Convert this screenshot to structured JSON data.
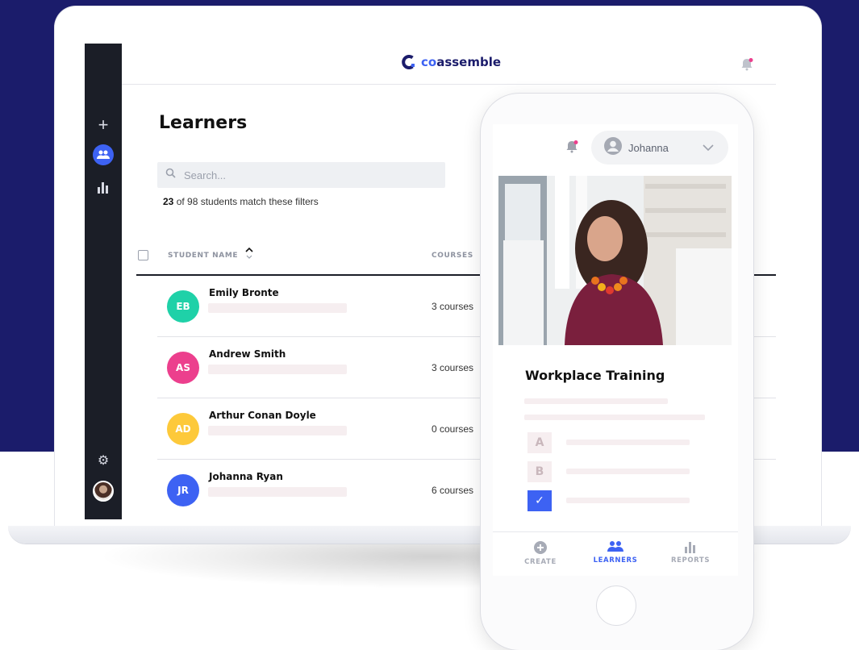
{
  "app": {
    "logo_text_co": "co",
    "logo_text_rest": "assemble",
    "accent_color": "#3d62f3",
    "navy_color": "#1b1c6b"
  },
  "sidebar": {
    "items": [
      {
        "name": "create",
        "icon": "plus-icon"
      },
      {
        "name": "learners",
        "icon": "users-icon",
        "active": true
      },
      {
        "name": "reports",
        "icon": "bar-chart-icon"
      },
      {
        "name": "settings",
        "icon": "gear-icon"
      },
      {
        "name": "profile",
        "icon": "avatar"
      }
    ]
  },
  "learners_page": {
    "title": "Learners",
    "search_placeholder": "Search...",
    "match_count": "23",
    "match_rest": " of 98 students match these filters",
    "columns": {
      "name": "STUDENT NAME",
      "courses": "COURSES"
    },
    "rows": [
      {
        "initials": "EB",
        "name": "Emily Bronte",
        "courses": "3 courses",
        "color": "#1fd1a8"
      },
      {
        "initials": "AS",
        "name": "Andrew Smith",
        "courses": "3 courses",
        "color": "#ec3f8d"
      },
      {
        "initials": "AD",
        "name": "Arthur Conan Doyle",
        "courses": "0 courses",
        "color": "#fdc93a"
      },
      {
        "initials": "JR",
        "name": "Johanna Ryan",
        "courses": "6 courses",
        "color": "#3d62f3"
      }
    ]
  },
  "phone": {
    "user_name": "Johanna",
    "course_title": "Workplace Training",
    "options": [
      "A",
      "B",
      "✓"
    ],
    "nav": [
      {
        "label": "CREATE",
        "icon": "plus-circle-icon"
      },
      {
        "label": "LEARNERS",
        "icon": "users-icon",
        "active": true
      },
      {
        "label": "REPORTS",
        "icon": "bar-chart-icon"
      }
    ]
  }
}
